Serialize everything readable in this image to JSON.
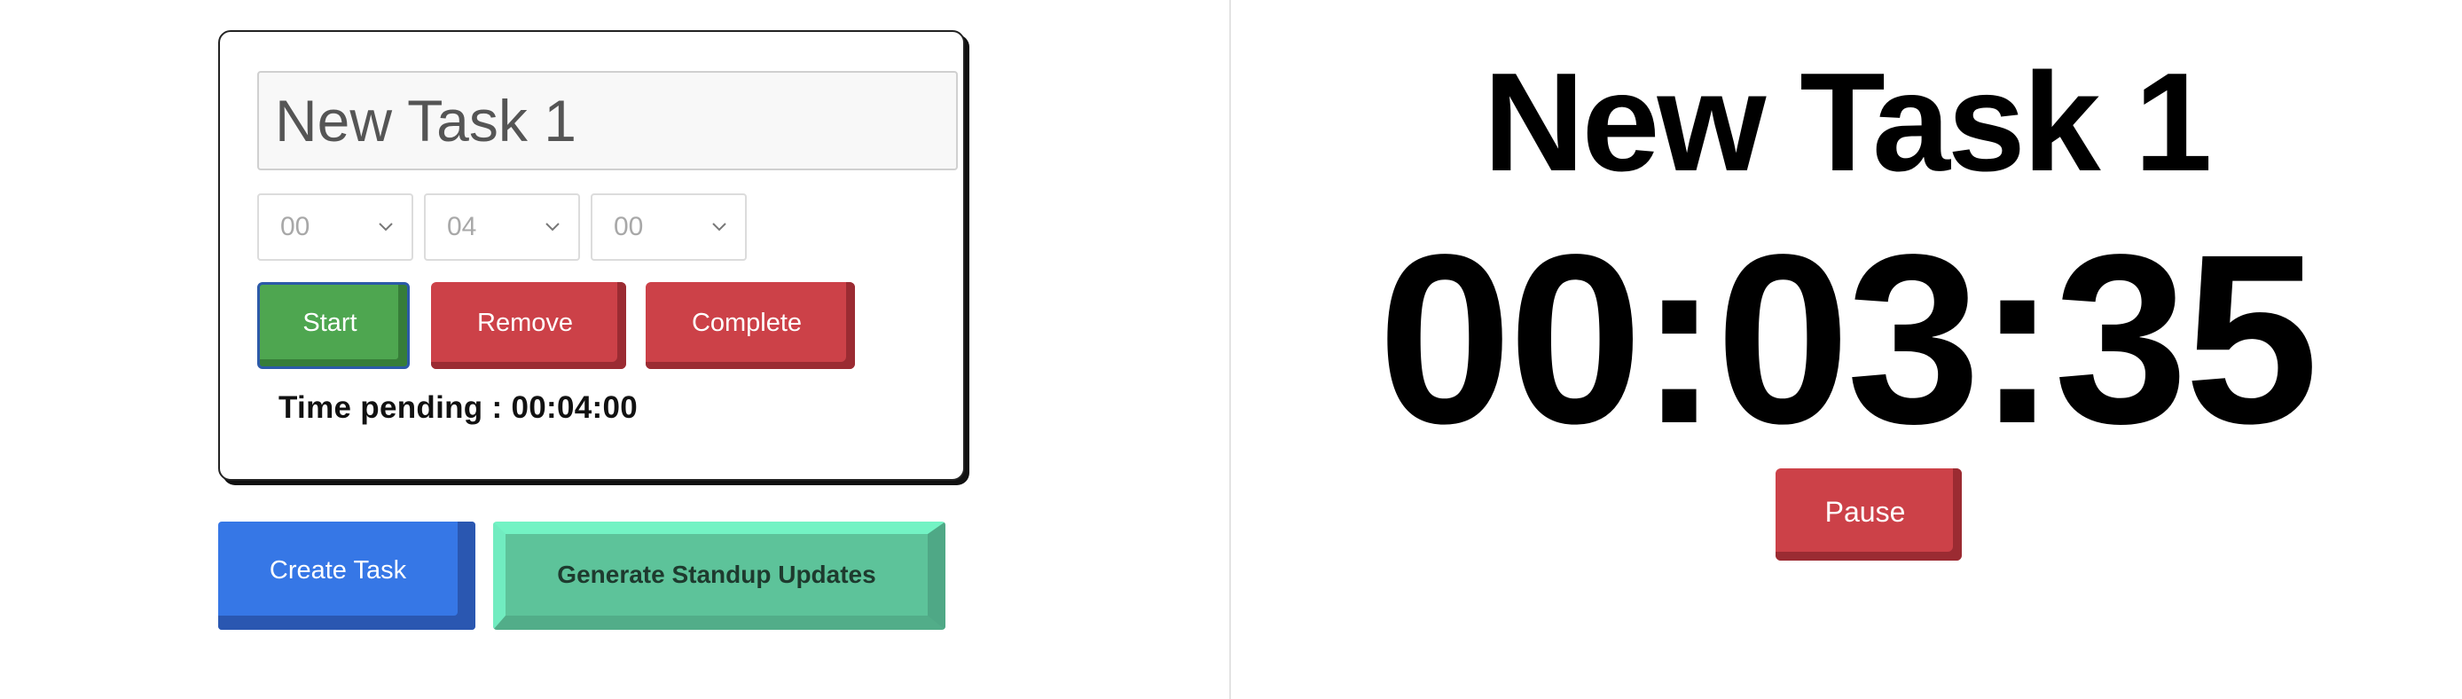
{
  "task_card": {
    "task_name_value": "New Task 1",
    "hours": "00",
    "minutes": "04",
    "seconds": "00",
    "start_label": "Start",
    "remove_label": "Remove",
    "complete_label": "Complete",
    "time_pending_text": "Time pending : 00:04:00"
  },
  "actions": {
    "create_task_label": "Create Task",
    "generate_standup_label": "Generate Standup Updates"
  },
  "timer": {
    "active_task_title": "New Task 1",
    "countdown": "00:03:35",
    "pause_label": "Pause"
  },
  "colors": {
    "start_green": "#4ea650",
    "danger_red": "#cc4148",
    "primary_blue": "#3677e6",
    "standup_green": "#5dc39a"
  },
  "icons": {
    "select_chevron": "chevron-down-icon"
  }
}
